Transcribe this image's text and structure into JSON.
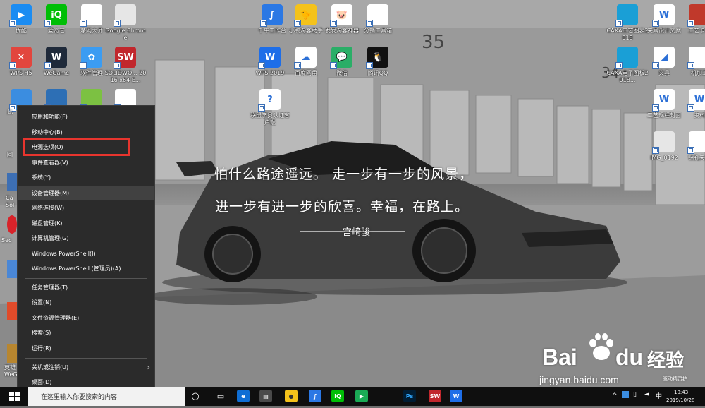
{
  "desktop": {
    "icons": [
      {
        "id": "youku",
        "label": "优酷",
        "color": "#1b8cf2",
        "glyph": "▶"
      },
      {
        "id": "iqiyi",
        "label": "爱奇艺",
        "color": "#00be06",
        "glyph": "iQ"
      },
      {
        "id": "jingwang",
        "label": "净网大师",
        "color": "#ffffff",
        "glyph": ""
      },
      {
        "id": "chrome",
        "label": "Google Chrome",
        "color": "#e6e6e6",
        "glyph": ""
      },
      {
        "id": "wpsh5",
        "label": "WPS H5",
        "color": "#e2463e",
        "glyph": "✕"
      },
      {
        "id": "wegame",
        "label": "WeGame",
        "color": "#1f2a3a",
        "glyph": "W"
      },
      {
        "id": "softmgr",
        "label": "软件管理",
        "color": "#3b9cf2",
        "glyph": "✿"
      },
      {
        "id": "solidworks",
        "label": "SOLIDWO... 2016 x64 E...",
        "color": "#c1272d",
        "glyph": "SW"
      },
      {
        "id": "pc",
        "label": "此",
        "color": "#3b8de0",
        "glyph": ""
      },
      {
        "id": "app2",
        "label": "",
        "color": "#2d6fb5",
        "glyph": ""
      },
      {
        "id": "app3",
        "label": "",
        "color": "#7cc142",
        "glyph": ""
      },
      {
        "id": "app4",
        "label": "",
        "color": "#ffffff",
        "glyph": ""
      },
      {
        "id": "kingsoft",
        "label": "千牛工作台",
        "color": "#2b78e4",
        "glyph": "∫"
      },
      {
        "id": "xiaoya",
        "label": "小鸭淘客助手",
        "color": "#f4c21b",
        "glyph": "🐤"
      },
      {
        "id": "fafa",
        "label": "发发淘客神器",
        "color": "#ffffff",
        "glyph": "🐷"
      },
      {
        "id": "fenxiao",
        "label": "分销工具箱",
        "color": "#ffffff",
        "glyph": ""
      },
      {
        "id": "wps2019",
        "label": "WPS 2019",
        "color": "#1e6ee8",
        "glyph": "W"
      },
      {
        "id": "baidupan",
        "label": "百度网盘",
        "color": "#ffffff",
        "glyph": "☁"
      },
      {
        "id": "wechat",
        "label": "微信",
        "color": "#2aae67",
        "glyph": "💬"
      },
      {
        "id": "qq",
        "label": "腾讯QQ",
        "color": "#111111",
        "glyph": "🐧"
      },
      {
        "id": "lianmeng",
        "label": "联盟学员认证客户端",
        "color": "#ffffff",
        "glyph": "?"
      },
      {
        "id": "caxa",
        "label": "CAXA工艺图表2018",
        "color": "#1a9fd6",
        "glyph": ""
      },
      {
        "id": "jiaju",
        "label": "夹具设计文案",
        "color": "#ffffff",
        "glyph": "W"
      },
      {
        "id": "gongyi1",
        "label": "工艺卡片",
        "color": "#c0392b",
        "glyph": ""
      },
      {
        "id": "caxa2",
        "label": "CAXA电子图板2018...",
        "color": "#1a9fd6",
        "glyph": ""
      },
      {
        "id": "jiaju2",
        "label": "夹具",
        "color": "#ffffff",
        "glyph": "◢"
      },
      {
        "id": "jiagong",
        "label": "机加工",
        "color": "#ffffff",
        "glyph": ""
      },
      {
        "id": "gongyi2",
        "label": "工艺规程封面",
        "color": "#ffffff",
        "glyph": "W"
      },
      {
        "id": "ziliao",
        "label": "资料",
        "color": "#ffffff",
        "glyph": "W"
      },
      {
        "id": "img",
        "label": "IMG_0192",
        "color": "#e6e6e6",
        "glyph": ""
      },
      {
        "id": "jiaju3",
        "label": "钻孔夹具",
        "color": "#ffffff",
        "glyph": ""
      }
    ],
    "left_partial_labels": [
      "此",
      "回",
      "Ca Sol",
      "Sec",
      "英雄 WeG"
    ]
  },
  "quote": {
    "line1": "怕什么路途遥远。 走一步有一步的风景，",
    "line2": "进一步有进一步的欣喜。幸福，在路上。",
    "author": "宫崎骏"
  },
  "context_menu": {
    "items": [
      {
        "label": "应用和功能(F)"
      },
      {
        "label": "移动中心(B)"
      },
      {
        "label": "电源选项(O)"
      },
      {
        "label": "事件查看器(V)"
      },
      {
        "label": "系统(Y)"
      },
      {
        "label": "设备管理器(M)"
      },
      {
        "label": "网络连接(W)"
      },
      {
        "label": "磁盘管理(K)"
      },
      {
        "label": "计算机管理(G)"
      },
      {
        "label": "Windows PowerShell(I)"
      },
      {
        "label": "Windows PowerShell (管理员)(A)"
      },
      {
        "label": "任务管理器(T)"
      },
      {
        "label": "设置(N)"
      },
      {
        "label": "文件资源管理器(E)"
      },
      {
        "label": "搜索(S)"
      },
      {
        "label": "运行(R)"
      },
      {
        "label": "关机或注销(U)"
      },
      {
        "label": "桌面(D)"
      }
    ],
    "highlighted": "设备管理器(M)",
    "red_box_item": "电源选项(O)"
  },
  "taskbar": {
    "search_placeholder": "在这里输入你要搜索的内容",
    "apps": [
      "cortana",
      "edge",
      "store",
      "xiaoya",
      "kingsoft",
      "iqiyi",
      "player",
      "photoshop",
      "solidworks",
      "wps"
    ],
    "clock_time": "10:43",
    "clock_date": "2019/10/28"
  },
  "watermark": {
    "brand": "Bai",
    "brand2": "du",
    "jingyan": "经验",
    "url": "jingyan.baidu.com",
    "small": "驱动精灵护"
  },
  "colors": {
    "highlight_red": "#e8352e",
    "menu_bg": "#2b2b2b",
    "taskbar_bg": "#0f0f0f"
  }
}
